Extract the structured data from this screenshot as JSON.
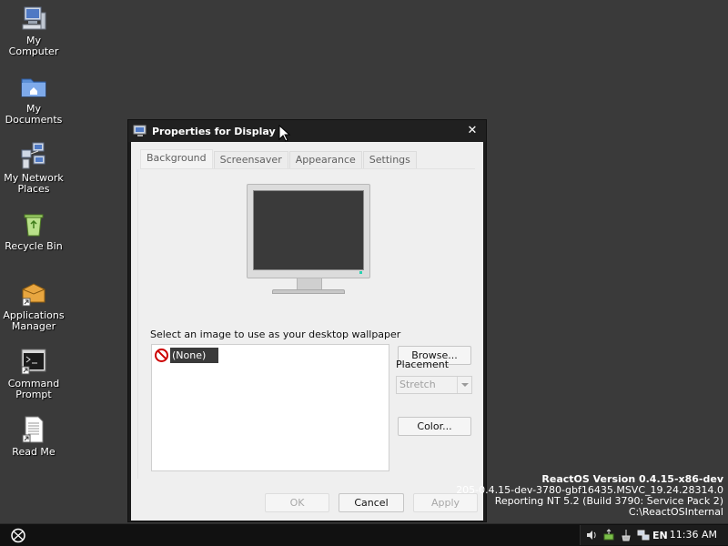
{
  "desktop": {
    "icons": [
      {
        "label": "My\nComputer",
        "icon": "computer-icon"
      },
      {
        "label": "My\nDocuments",
        "icon": "documents-folder-icon"
      },
      {
        "label": "My Network\nPlaces",
        "icon": "network-places-icon"
      },
      {
        "label": "Recycle Bin",
        "icon": "recycle-bin-icon"
      },
      {
        "label": "Applications\nManager",
        "icon": "applications-manager-icon"
      },
      {
        "label": "Command\nPrompt",
        "icon": "command-prompt-icon"
      },
      {
        "label": "Read Me",
        "icon": "read-me-icon"
      }
    ],
    "icon_labels": {
      "my_computer_1": "My",
      "my_computer_2": "Computer",
      "my_documents_1": "My",
      "my_documents_2": "Documents",
      "network_1": "My Network",
      "network_2": "Places",
      "recycle": "Recycle Bin",
      "appmgr_1": "Applications",
      "appmgr_2": "Manager",
      "cmd_1": "Command",
      "cmd_2": "Prompt",
      "readme": "Read Me"
    }
  },
  "window": {
    "title": "Properties for Display",
    "tabs": {
      "background": "Background",
      "screensaver": "Screensaver",
      "appearance": "Appearance",
      "settings": "Settings"
    },
    "active_tab": "Background",
    "wallpaper_prompt": "Select an image to use as your desktop wallpaper",
    "wallpaper_items": [
      "(None)"
    ],
    "selected_wallpaper": "(None)",
    "browse_button": "Browse...",
    "placement_label": "Placement",
    "placement_value": "Stretch",
    "color_button": "Color...",
    "ok_button": "OK",
    "cancel_button": "Cancel",
    "apply_button": "Apply"
  },
  "version_info": {
    "line1": "ReactOS Version 0.4.15-x86-dev",
    "line2": "205-0.4.15-dev-3780-gbf16435.MSVC_19.24.28314.0",
    "line3": "Reporting NT 5.2 (Build 3790: Service Pack 2)",
    "line4": "C:\\ReactOSInternal"
  },
  "taskbar": {
    "language": "EN",
    "clock": "11:36 AM"
  },
  "colors": {
    "desktop_bg": "#3a3a3a",
    "window_frame": "#1b1b1b",
    "client_bg": "#efefef",
    "selection_bg": "#3a3a3a",
    "taskbar_bg": "#111111"
  }
}
